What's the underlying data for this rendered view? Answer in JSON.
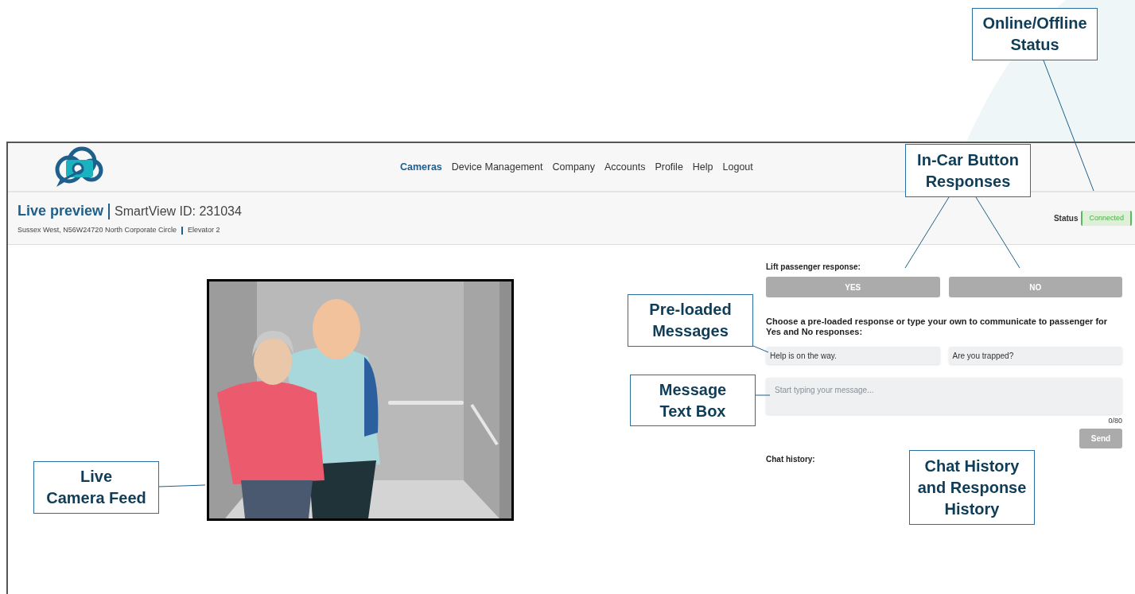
{
  "nav": [
    {
      "label": "Cameras",
      "selected": true
    },
    {
      "label": "Device Management",
      "selected": false
    },
    {
      "label": "Company",
      "selected": false
    },
    {
      "label": "Accounts",
      "selected": false
    },
    {
      "label": "Profile",
      "selected": false
    },
    {
      "label": "Help",
      "selected": false
    },
    {
      "label": "Logout",
      "selected": false
    }
  ],
  "page_header": {
    "title": "Live preview",
    "device_id": "SmartView ID: 231034",
    "address": "Sussex West, N56W24720 North Corporate Circle",
    "car": "Elevator 2",
    "status_label": "Status",
    "status_value": "Connected"
  },
  "response_panel": {
    "label": "Lift passenger response:",
    "buttons": [
      "YES",
      "NO"
    ],
    "instructions": "Choose a pre-loaded response or type your own to communicate to passenger for Yes and No responses:",
    "preloaded": [
      "Help is on the way.",
      "Are you trapped?"
    ],
    "message_box": {
      "placeholder": "Start typing your message...",
      "counter": "0/80"
    },
    "send": "Send",
    "chat_history": "Chat history:"
  },
  "callouts": [
    {
      "text": "Online/Offline\nStatus"
    },
    {
      "text": "In-Car Button\nResponses"
    },
    {
      "text": "Pre-loaded\nMessages"
    },
    {
      "text": "Message\nText Box"
    },
    {
      "text": "Live\nCamera Feed"
    },
    {
      "text": "Chat History\nand Response\nHistory"
    }
  ]
}
